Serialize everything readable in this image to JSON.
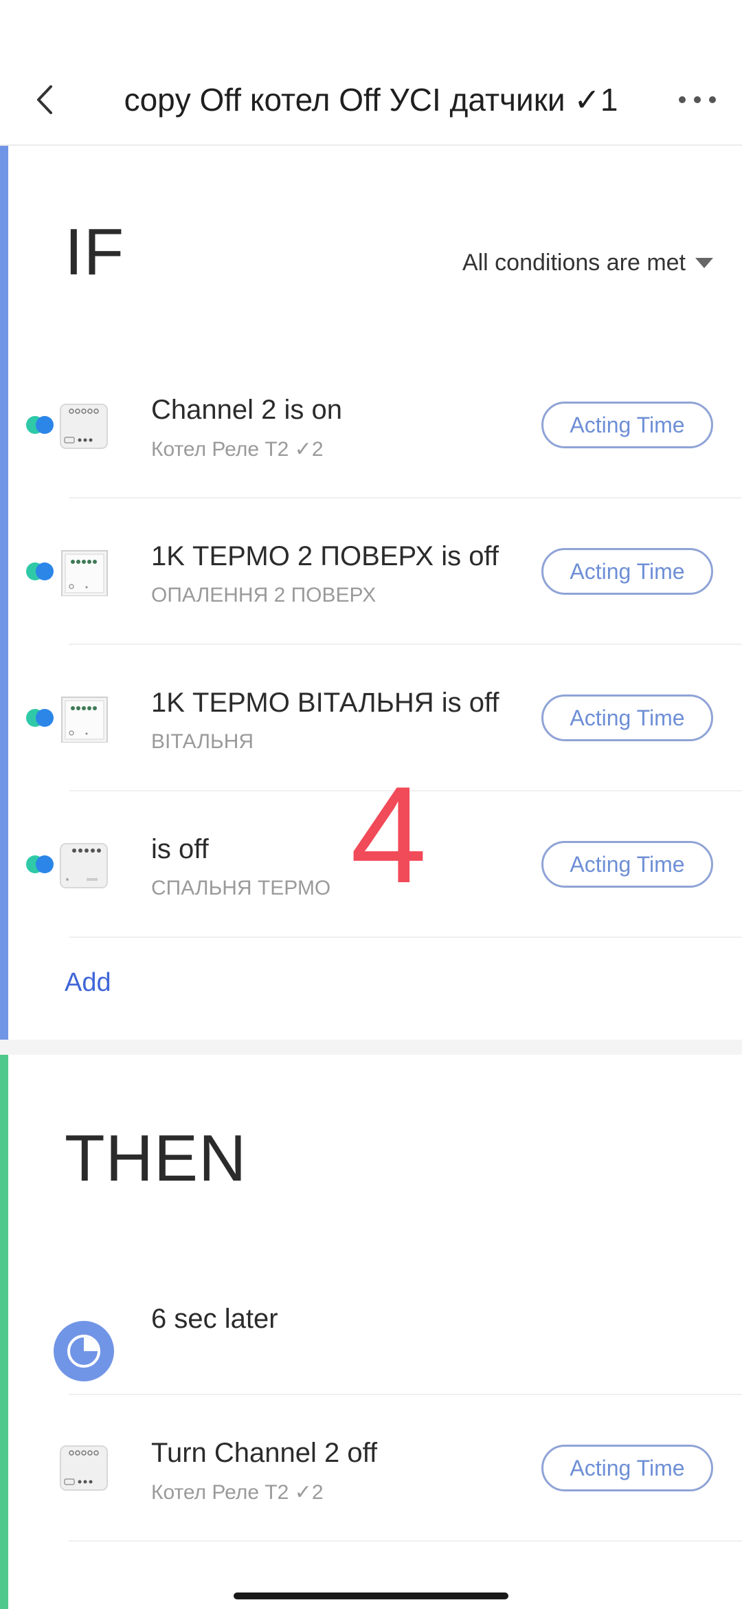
{
  "header": {
    "title": "copy Off котел Off УСІ датчики ✓1",
    "back_icon": "chevron-left-icon",
    "more_icon": "more-dots-icon"
  },
  "if_section": {
    "heading": "IF",
    "condition_mode": "All conditions are met",
    "accent_color": "#7195e6",
    "conditions": [
      {
        "title": "Channel 2 is on",
        "subtitle": "Котел Реле  T2 ✓2",
        "button": "Acting Time",
        "icon": "relay-module-icon"
      },
      {
        "title": "1K ТЕРМО 2 ПОВЕРХ is off",
        "subtitle": "ОПАЛЕННЯ 2 ПОВЕРХ",
        "button": "Acting Time",
        "icon": "wall-switch-icon"
      },
      {
        "title": "1K ТЕРМО ВІТАЛЬНЯ is off",
        "subtitle": "ВІТАЛЬНЯ",
        "button": "Acting Time",
        "icon": "wall-switch-icon"
      },
      {
        "title": "is off",
        "subtitle": "СПАЛЬНЯ ТЕРМО",
        "button": "Acting Time",
        "icon": "relay-module-icon"
      }
    ],
    "add_label": "Add",
    "overlay_number": "4"
  },
  "then_section": {
    "heading": "THEN",
    "accent_color": "#4fc98c",
    "actions": [
      {
        "title": "6 sec later",
        "icon": "timer-icon"
      },
      {
        "title": "Turn Channel 2 off",
        "subtitle": "Котел Реле  T2 ✓2",
        "button": "Acting Time",
        "icon": "relay-module-icon"
      }
    ]
  }
}
